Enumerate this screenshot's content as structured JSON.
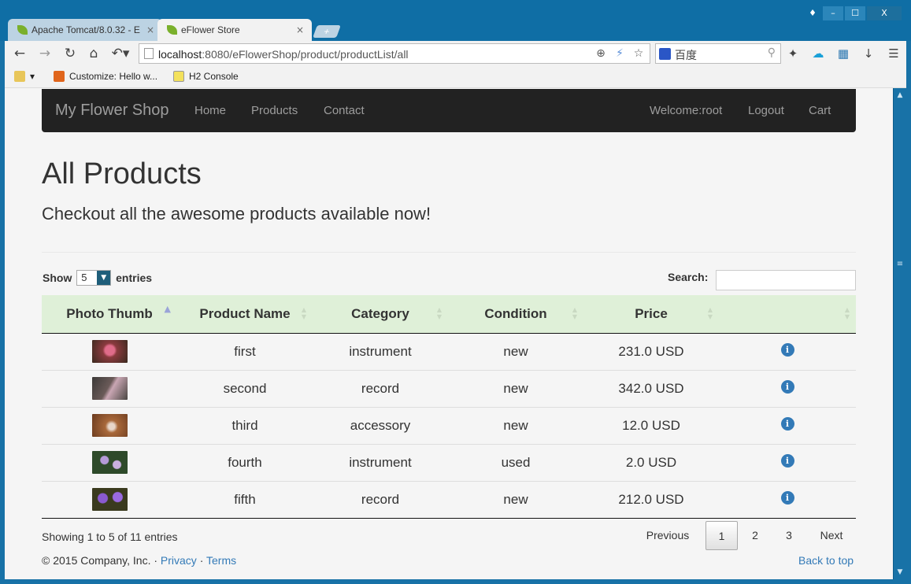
{
  "browser": {
    "tabs": [
      {
        "title": "Apache Tomcat/8.0.32 - E",
        "active": false
      },
      {
        "title": "eFlower Store",
        "active": true
      }
    ],
    "new_tab_label": "+",
    "window_controls": {
      "minimize": "–",
      "maximize": "☐",
      "close": "X"
    },
    "url_host": "localhost",
    "url_path": ":8080/eFlowerShop/product/productList/all",
    "search_engine": "百度",
    "bookmarks": [
      {
        "label": "Customize: Hello w...",
        "icon": "customize-icon",
        "color": "#e0651c"
      },
      {
        "label": "H2 Console",
        "icon": "h2-console-icon",
        "color": "#f3e15c"
      }
    ]
  },
  "nav": {
    "brand": "My Flower Shop",
    "links": [
      "Home",
      "Products",
      "Contact"
    ],
    "welcome": "Welcome:root",
    "logout": "Logout",
    "cart": "Cart"
  },
  "header": {
    "title": "All Products",
    "subtitle": "Checkout all the awesome products available now!"
  },
  "controls": {
    "show_label": "Show",
    "page_length": "5",
    "entries_label": "entries",
    "search_label": "Search:",
    "search_value": ""
  },
  "table": {
    "columns": [
      "Photo Thumb",
      "Product Name",
      "Category",
      "Condition",
      "Price",
      ""
    ],
    "rows": [
      {
        "name": "first",
        "category": "instrument",
        "condition": "new",
        "price": "231.0 USD",
        "thumb_color": "#8a3a3e",
        "thumb_accent": "#e06c8a"
      },
      {
        "name": "second",
        "category": "record",
        "condition": "new",
        "price": "342.0 USD",
        "thumb_color": "#4a4642",
        "thumb_accent": "#c9a6b3"
      },
      {
        "name": "third",
        "category": "accessory",
        "condition": "new",
        "price": "12.0 USD",
        "thumb_color": "#7a4a2a",
        "thumb_accent": "#e8d6c9"
      },
      {
        "name": "fourth",
        "category": "instrument",
        "condition": "used",
        "price": "2.0 USD",
        "thumb_color": "#2e4a2a",
        "thumb_accent": "#b59ad8"
      },
      {
        "name": "fifth",
        "category": "record",
        "condition": "new",
        "price": "212.0 USD",
        "thumb_color": "#3a3a1e",
        "thumb_accent": "#8a5ad0"
      }
    ],
    "info_icon_glyph": "i"
  },
  "pagination": {
    "info": "Showing 1 to 5 of 11 entries",
    "previous": "Previous",
    "pages": [
      "1",
      "2",
      "3"
    ],
    "current_page": "1",
    "next": "Next"
  },
  "footer": {
    "copyright": "© 2015 Company, Inc. · ",
    "privacy": "Privacy",
    "separator": " · ",
    "terms": "Terms",
    "back_to_top": "Back to top"
  },
  "colors": {
    "navbar_bg": "#222222",
    "table_header_bg": "#dff0d8",
    "link": "#337ab7",
    "window_frame": "#1872a7"
  }
}
